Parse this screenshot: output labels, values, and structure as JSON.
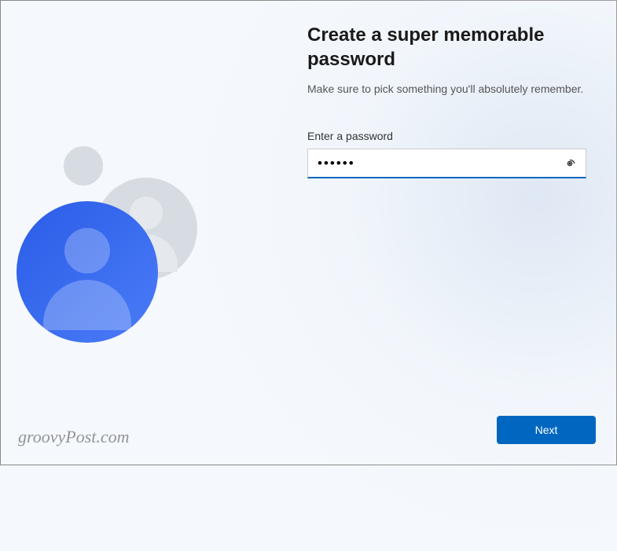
{
  "header": {
    "title": "Create a super memorable password",
    "subtitle": "Make sure to pick something you'll absolutely remember."
  },
  "form": {
    "password_label": "Enter a password",
    "password_value": "••••••",
    "reveal_tooltip": "Show password"
  },
  "footer": {
    "next_label": "Next"
  },
  "watermark": "groovyPost.com"
}
